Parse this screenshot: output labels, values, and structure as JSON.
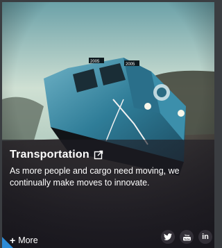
{
  "card": {
    "title": "Transportation",
    "description": "As more people and cargo need moving, we continually make moves to innovate.",
    "more_label": "More",
    "more_plus": "+"
  },
  "image": {
    "subject": "locomotive-photo",
    "locomotive_numbers": [
      "2005",
      "2005"
    ]
  },
  "socials": {
    "twitter": "twitter-icon",
    "youtube_label": "You Tube",
    "linkedin_label": "in"
  },
  "colors": {
    "accent": "#2d8bd6",
    "caption_bg": "#1e1c24",
    "text": "#ffffff"
  }
}
